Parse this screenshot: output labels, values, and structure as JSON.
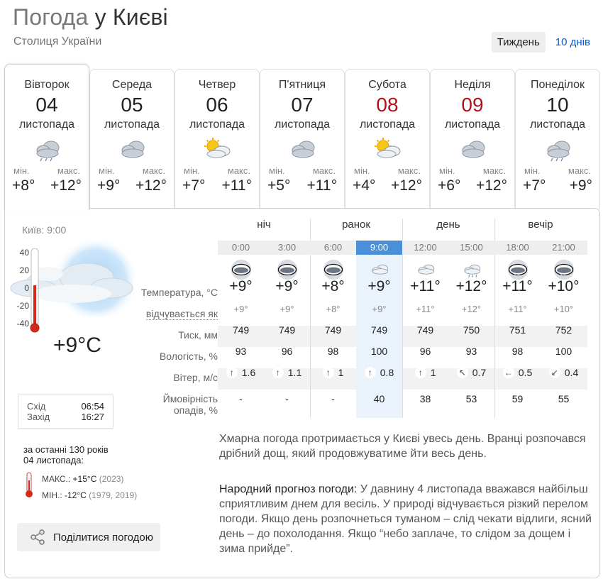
{
  "header": {
    "title_prefix": "Погода",
    "title_city": "у Києві",
    "subtitle": "Столиця України",
    "tabs": [
      {
        "label": "Тиждень",
        "active": true
      },
      {
        "label": "10 днів",
        "active": false
      }
    ]
  },
  "days": [
    {
      "name": "Вівторок",
      "num": "04",
      "month": "листопада",
      "min_label": "мін.",
      "max_label": "макс.",
      "min": "+8°",
      "max": "+12°",
      "icon": "cloud-rain-icon",
      "weekend": false,
      "active": true
    },
    {
      "name": "Середа",
      "num": "05",
      "month": "листопада",
      "min_label": "мін.",
      "max_label": "макс.",
      "min": "+9°",
      "max": "+12°",
      "icon": "cloud-icon",
      "weekend": false,
      "active": false
    },
    {
      "name": "Четвер",
      "num": "06",
      "month": "листопада",
      "min_label": "мін.",
      "max_label": "макс.",
      "min": "+7°",
      "max": "+11°",
      "icon": "sun-cloud-icon",
      "weekend": false,
      "active": false
    },
    {
      "name": "П'ятниця",
      "num": "07",
      "month": "листопада",
      "min_label": "мін.",
      "max_label": "макс.",
      "min": "+5°",
      "max": "+11°",
      "icon": "cloud-icon",
      "weekend": false,
      "active": false
    },
    {
      "name": "Субота",
      "num": "08",
      "month": "листопада",
      "min_label": "мін.",
      "max_label": "макс.",
      "min": "+4°",
      "max": "+12°",
      "icon": "sun-cloud-icon",
      "weekend": true,
      "active": false
    },
    {
      "name": "Неділя",
      "num": "09",
      "month": "листопада",
      "min_label": "мін.",
      "max_label": "макс.",
      "min": "+6°",
      "max": "+12°",
      "icon": "cloud-icon",
      "weekend": true,
      "active": false
    },
    {
      "name": "Понеділок",
      "num": "10",
      "month": "листопада",
      "min_label": "мін.",
      "max_label": "макс.",
      "min": "+7°",
      "max": "+9°",
      "icon": "cloud-rain-icon",
      "weekend": false,
      "active": false
    }
  ],
  "now": {
    "time": "Київ: 9:00",
    "temp": "+9°C",
    "scale": [
      "40",
      "20",
      "0",
      "-20",
      "-40"
    ],
    "sunrise_label": "Схід",
    "sunrise": "06:54",
    "sunset_label": "Захід",
    "sunset": "16:27"
  },
  "history": {
    "line1": "за останні 130 років",
    "line2": "04 листопада:",
    "max_label": "МАКС.:",
    "max_value": "+15°C",
    "max_years": "(2023)",
    "min_label": "МІН.:",
    "min_value": "-12°C",
    "min_years": "(1979, 2019)"
  },
  "share_label": "Поділитися погодою",
  "rows": {
    "temp": "Температура, °C",
    "feels": "відчувається як",
    "pressure": "Тиск, мм",
    "humidity": "Вологість, %",
    "wind": "Вітер, м/с",
    "precip1": "Ймовірність",
    "precip2": "опадів, %"
  },
  "periods": [
    "ніч",
    "ранок",
    "день",
    "вечір"
  ],
  "hours": [
    {
      "time": "0:00",
      "icon": "night-cloud-icon",
      "temp": "+9°",
      "feels": "+9°",
      "pressure": "749",
      "humidity": "93",
      "wind_dir": "↑",
      "wind": "1.6",
      "precip": "-",
      "now": false
    },
    {
      "time": "3:00",
      "icon": "night-cloud-icon",
      "temp": "+9°",
      "feels": "+9°",
      "pressure": "749",
      "humidity": "96",
      "wind_dir": "↑",
      "wind": "1.1",
      "precip": "-",
      "now": false
    },
    {
      "time": "6:00",
      "icon": "night-cloud-icon",
      "temp": "+8°",
      "feels": "+8°",
      "pressure": "749",
      "humidity": "98",
      "wind_dir": "↑",
      "wind": "1",
      "precip": "-",
      "now": false
    },
    {
      "time": "9:00",
      "icon": "light-cloud-icon",
      "temp": "+9°",
      "feels": "+9°",
      "pressure": "749",
      "humidity": "100",
      "wind_dir": "↑",
      "wind": "0.8",
      "precip": "40",
      "now": true
    },
    {
      "time": "12:00",
      "icon": "light-cloud-icon",
      "temp": "+11°",
      "feels": "+11°",
      "pressure": "749",
      "humidity": "96",
      "wind_dir": "↑",
      "wind": "1",
      "precip": "38",
      "now": false
    },
    {
      "time": "15:00",
      "icon": "light-rain-icon",
      "temp": "+12°",
      "feels": "+12°",
      "pressure": "750",
      "humidity": "93",
      "wind_dir": "↖",
      "wind": "0.7",
      "precip": "53",
      "now": false
    },
    {
      "time": "18:00",
      "icon": "night-rain-icon",
      "temp": "+11°",
      "feels": "+11°",
      "pressure": "751",
      "humidity": "98",
      "wind_dir": "←",
      "wind": "0.5",
      "precip": "59",
      "now": false
    },
    {
      "time": "21:00",
      "icon": "night-rain-icon",
      "temp": "+10°",
      "feels": "+10°",
      "pressure": "752",
      "humidity": "100",
      "wind_dir": "↙",
      "wind": "0.4",
      "precip": "55",
      "now": false
    }
  ],
  "description": "Хмарна погода протримається у Києві увесь день. Вранці розпочався дрібний дощ, який продовжуватиме йти весь день.",
  "folk": {
    "heading": "Народний прогноз погоди:",
    "text": " У давнину 4 листопада вважався найбільш сприятливим днем для весіль. У природі відчувається різкий перелом погоди. Якщо день розпочнеться туманом – слід чекати відлиги, ясний день – до похолодання. Якщо “небо заплаче, то слідом за дощем і зима прийде”."
  }
}
